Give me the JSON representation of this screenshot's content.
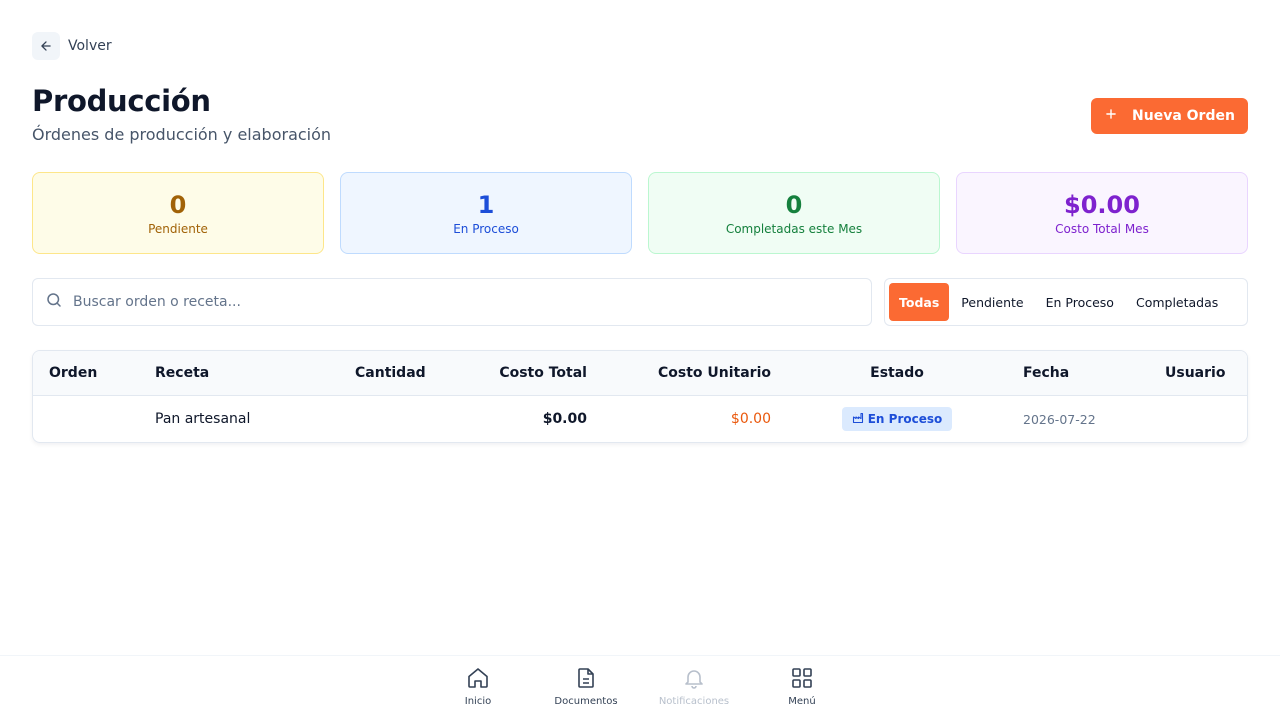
{
  "back": {
    "label": "Volver"
  },
  "header": {
    "title": "Producción",
    "subtitle": "Órdenes de producción y elaboración",
    "new_button_label": "Nueva Orden"
  },
  "stats": [
    {
      "value": "0",
      "label": "Pendiente",
      "color": "#a16207"
    },
    {
      "value": "1",
      "label": "En Proceso",
      "color": "#1d4ed8"
    },
    {
      "value": "0",
      "label": "Completadas este Mes",
      "color": "#15803d"
    },
    {
      "value": "$0.00",
      "label": "Costo Total Mes",
      "color": "#7e22ce"
    }
  ],
  "search": {
    "placeholder": "Buscar orden o receta...",
    "value": ""
  },
  "filters": [
    {
      "label": "Todas",
      "active": true
    },
    {
      "label": "Pendiente",
      "active": false
    },
    {
      "label": "En Proceso",
      "active": false
    },
    {
      "label": "Completadas",
      "active": false
    }
  ],
  "table": {
    "columns": [
      "Orden",
      "Receta",
      "Cantidad",
      "Costo Total",
      "Costo Unitario",
      "Estado",
      "Fecha",
      "Usuario"
    ],
    "rows": [
      {
        "orden": "",
        "receta": "Pan artesanal",
        "cantidad": "",
        "costo_total": "$0.00",
        "costo_unitario": "$0.00",
        "estado": "En Proceso",
        "fecha": "2026-07-22",
        "usuario": ""
      }
    ]
  },
  "bottom_nav": [
    {
      "label": "Inicio",
      "icon": "home-icon"
    },
    {
      "label": "Documentos",
      "icon": "document-icon"
    },
    {
      "label": "Notificaciones",
      "icon": "bell-icon"
    },
    {
      "label": "Menú",
      "icon": "grid-icon"
    }
  ],
  "colors": {
    "accent": "#fb6a33",
    "badge_blue": "#dbeafe"
  }
}
